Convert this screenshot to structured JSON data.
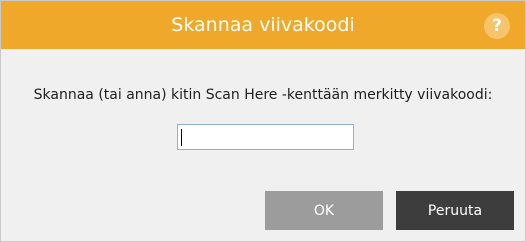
{
  "dialog": {
    "title": "Skannaa viivakoodi",
    "help_label": "?",
    "message": "Skannaa (tai anna) kitin Scan Here -kenttään merkitty viivakoodi:",
    "barcode_input": {
      "value": "",
      "placeholder": ""
    },
    "buttons": {
      "ok_label": "OK",
      "cancel_label": "Peruuta"
    }
  },
  "colors": {
    "titlebar": "#f0a82a",
    "ok_button": "#9c9c9c",
    "cancel_button": "#3d3d3d",
    "background": "#f0f0f0"
  }
}
